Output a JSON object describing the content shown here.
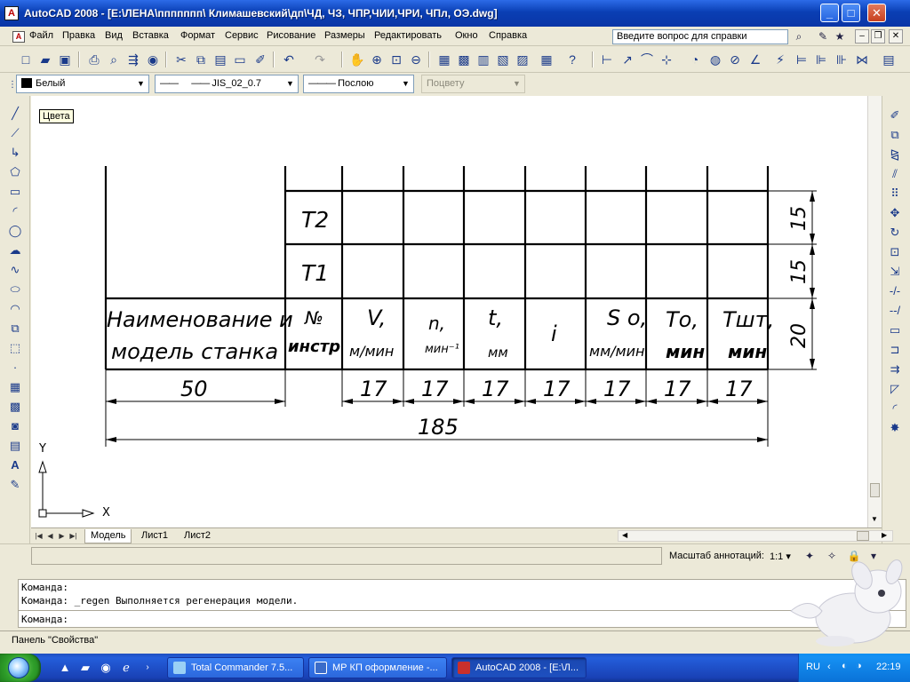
{
  "window": {
    "title": "AutoCAD 2008 - [E:\\ЛЕНА\\ппппппп\\ Климашевский\\дп\\ЧД, ЧЗ, ЧПР,ЧИИ,ЧРИ, ЧПл, ОЭ.dwg]",
    "app_icon_glyph": "A",
    "controls": {
      "minimize": "_",
      "maximize": "□",
      "close": "✕"
    }
  },
  "menu": {
    "items": [
      "Файл",
      "Правка",
      "Вид",
      "Вставка",
      "Формат",
      "Сервис",
      "Рисование",
      "Размеры",
      "Редактировать",
      "Окно",
      "Справка"
    ],
    "help_search_placeholder": "Введите вопрос для справки",
    "mdi_controls": {
      "minimize": "–",
      "restore": "❐",
      "close": "✕"
    }
  },
  "properties_toolbar": {
    "color": "Белый",
    "linetype": "JIS_02_0.7",
    "lineweight": "Послою",
    "plotstyle": "Поцвету"
  },
  "tooltip": "Цвета",
  "drawing": {
    "rows_upper": [
      "Т2",
      "Т1"
    ],
    "header_name": [
      "Наименование и",
      "модель станка"
    ],
    "header_no": [
      "№",
      "инстр"
    ],
    "columns": [
      {
        "symbol": "V,",
        "unit": "м/мин"
      },
      {
        "symbol": "n,",
        "unit": "мин⁻¹"
      },
      {
        "symbol": "t,",
        "unit": "мм"
      },
      {
        "symbol": "i",
        "unit": ""
      },
      {
        "symbol": "S о,",
        "unit": "мм/мин"
      },
      {
        "symbol": "То,",
        "unit": "мин"
      },
      {
        "symbol": "Тшт,",
        "unit": "мин"
      }
    ],
    "dim_name_width": "50",
    "dim_col_width": "17",
    "dim_total": "185",
    "dim_row_heights": [
      "15",
      "15",
      "20"
    ],
    "ucs": {
      "x": "X",
      "y": "Y"
    }
  },
  "layout_tabs": [
    "Модель",
    "Лист1",
    "Лист2"
  ],
  "annotation": {
    "label": "Масштаб аннотаций:",
    "value": "1:1 ▾"
  },
  "command_window": {
    "lines": [
      "Команда:",
      "Команда: _regen Выполняется регенерация модели."
    ],
    "prompt": "Команда:"
  },
  "panel_status": "Панель \"Свойства\"",
  "taskbar": {
    "tasks": [
      {
        "label": "Total Commander 7.5...",
        "active": false
      },
      {
        "label": "МР КП оформление -...",
        "active": false
      },
      {
        "label": "AutoCAD 2008 - [E:\\Л...",
        "active": true
      }
    ],
    "language": "RU",
    "clock": "22:19"
  }
}
